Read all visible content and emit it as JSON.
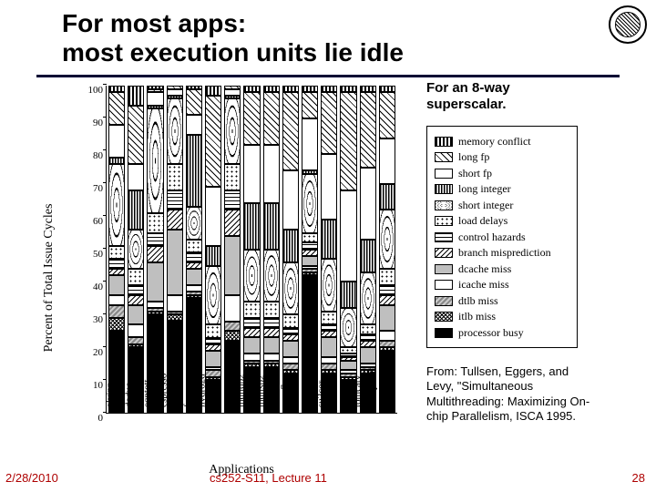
{
  "title_line1": "For most apps:",
  "title_line2": "most execution units lie idle",
  "subtitle_line1": "For an 8-way",
  "subtitle_line2": "superscalar.",
  "citation": "From: Tullsen, Eggers, and Levy, \"Simultaneous Multithreading: Maximizing On-chip Parallelism, ISCA 1995.",
  "footer": {
    "date": "2/28/2010",
    "center": "cs252-S11, Lecture 11",
    "page": "28"
  },
  "axis": {
    "y": "Percent of Total Issue Cycles",
    "x": "Applications"
  },
  "chart_data": {
    "type": "bar",
    "ylabel": "Percent of Total Issue Cycles",
    "xlabel": "Applications",
    "ylim": [
      0,
      100
    ],
    "yticks": [
      0,
      10,
      20,
      30,
      40,
      50,
      60,
      70,
      80,
      90,
      100
    ],
    "categories": [
      "alvinn",
      "doduc",
      "eqntott",
      "espresso",
      "fpppp",
      "hydro2d",
      "li",
      "mdljdp2",
      "mdljsp2",
      "nasa7",
      "ora",
      "su2cor",
      "swm",
      "tomcatv",
      "composite"
    ],
    "stack_order": [
      "processor_busy",
      "itlb_miss",
      "dtlb_miss",
      "icache_miss",
      "dcache_miss",
      "branch_mispred",
      "control_hazards",
      "load_delays",
      "short_integer",
      "long_integer",
      "short_fp",
      "long_fp",
      "memory_conflict"
    ],
    "series": {
      "processor_busy": [
        25,
        20,
        30,
        28,
        35,
        10,
        22,
        14,
        14,
        12,
        42,
        12,
        10,
        12,
        19
      ],
      "itlb_miss": [
        4,
        1,
        1,
        2,
        1,
        1,
        3,
        1,
        1,
        1,
        1,
        1,
        1,
        1,
        1
      ],
      "dtlb_miss": [
        4,
        2,
        1,
        1,
        1,
        2,
        3,
        1,
        1,
        2,
        1,
        2,
        1,
        1,
        2
      ],
      "icache_miss": [
        3,
        4,
        2,
        5,
        2,
        1,
        8,
        2,
        2,
        2,
        1,
        2,
        1,
        1,
        3
      ],
      "dcache_miss": [
        6,
        6,
        12,
        20,
        5,
        5,
        18,
        5,
        5,
        5,
        3,
        6,
        3,
        5,
        8
      ],
      "branch_mispred": [
        2,
        3,
        5,
        6,
        2,
        2,
        8,
        3,
        3,
        2,
        2,
        2,
        1,
        2,
        3
      ],
      "control_hazards": [
        3,
        3,
        4,
        6,
        3,
        2,
        6,
        3,
        3,
        2,
        2,
        2,
        1,
        2,
        3
      ],
      "load_delays": [
        4,
        5,
        6,
        8,
        4,
        4,
        8,
        5,
        5,
        4,
        3,
        4,
        2,
        3,
        5
      ],
      "short_integer": [
        25,
        12,
        32,
        20,
        10,
        18,
        20,
        16,
        16,
        16,
        18,
        16,
        12,
        16,
        18
      ],
      "long_integer": [
        2,
        12,
        1,
        1,
        22,
        6,
        1,
        14,
        14,
        10,
        1,
        12,
        8,
        10,
        8
      ],
      "short_fp": [
        10,
        8,
        4,
        2,
        6,
        18,
        2,
        18,
        18,
        18,
        16,
        20,
        28,
        22,
        14
      ],
      "long_fp": [
        10,
        18,
        1,
        1,
        8,
        28,
        1,
        16,
        16,
        24,
        8,
        19,
        30,
        23,
        14
      ],
      "memory_conflict": [
        2,
        6,
        1,
        0,
        1,
        3,
        0,
        2,
        2,
        2,
        2,
        2,
        2,
        2,
        2
      ]
    },
    "legend": [
      {
        "key": "memory_conflict",
        "label": "memory conflict"
      },
      {
        "key": "long_fp",
        "label": "long fp"
      },
      {
        "key": "short_fp",
        "label": "short fp"
      },
      {
        "key": "long_integer",
        "label": "long integer"
      },
      {
        "key": "short_integer",
        "label": "short integer"
      },
      {
        "key": "load_delays",
        "label": "load delays"
      },
      {
        "key": "control_hazards",
        "label": "control hazards"
      },
      {
        "key": "branch_mispred",
        "label": "branch misprediction"
      },
      {
        "key": "dcache_miss",
        "label": "dcache miss"
      },
      {
        "key": "icache_miss",
        "label": "icache miss"
      },
      {
        "key": "dtlb_miss",
        "label": "dtlb miss"
      },
      {
        "key": "itlb_miss",
        "label": "itlb miss"
      },
      {
        "key": "processor_busy",
        "label": "processor busy"
      }
    ]
  }
}
